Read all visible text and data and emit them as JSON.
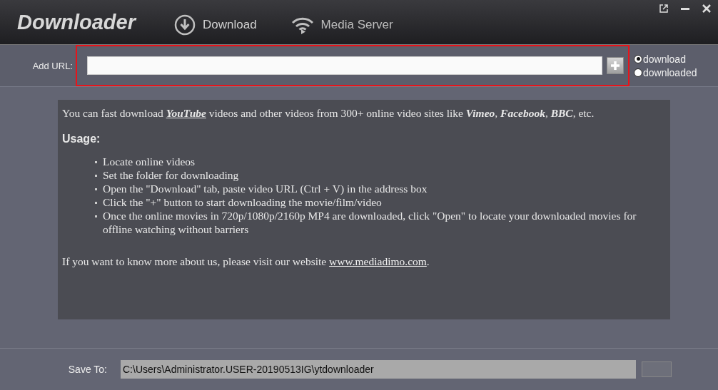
{
  "window": {
    "title": "Downloader"
  },
  "tabs": [
    {
      "label": "Download",
      "selected": true
    },
    {
      "label": "Media Server",
      "selected": false
    }
  ],
  "url_bar": {
    "label": "Add URL:",
    "highlighted": true
  },
  "filters": [
    {
      "label": "download",
      "selected": true
    },
    {
      "label": "downloaded",
      "selected": false
    }
  ],
  "info": {
    "intro": "You can fast download **YouTube** videos and other videos from 300+ online video sites like **Vimeo**, **Facebook**, **BBC**, etc.",
    "usage_title": "Usage:",
    "steps": [
      "Locate online videos",
      "Set the folder for downloading",
      "Open the \"Download\" tab, paste video URL (Ctrl + V) in the address box",
      "Click the \"+\" button to start downloading the movie/film/video",
      "Once the online movies in 720p/1080p/2160p MP4 are downloaded, click \"Open\" to locate your downloaded movies for offline watching without barriers"
    ],
    "footer": "If you want to know more about us, please visit our website ",
    "link": "www.mediadimo.com",
    "footer_end": "."
  },
  "save_to": {
    "label": "Save To:",
    "value": "C:\\Users\\Administrator.USER-20190513IG\\ytdownloader"
  }
}
